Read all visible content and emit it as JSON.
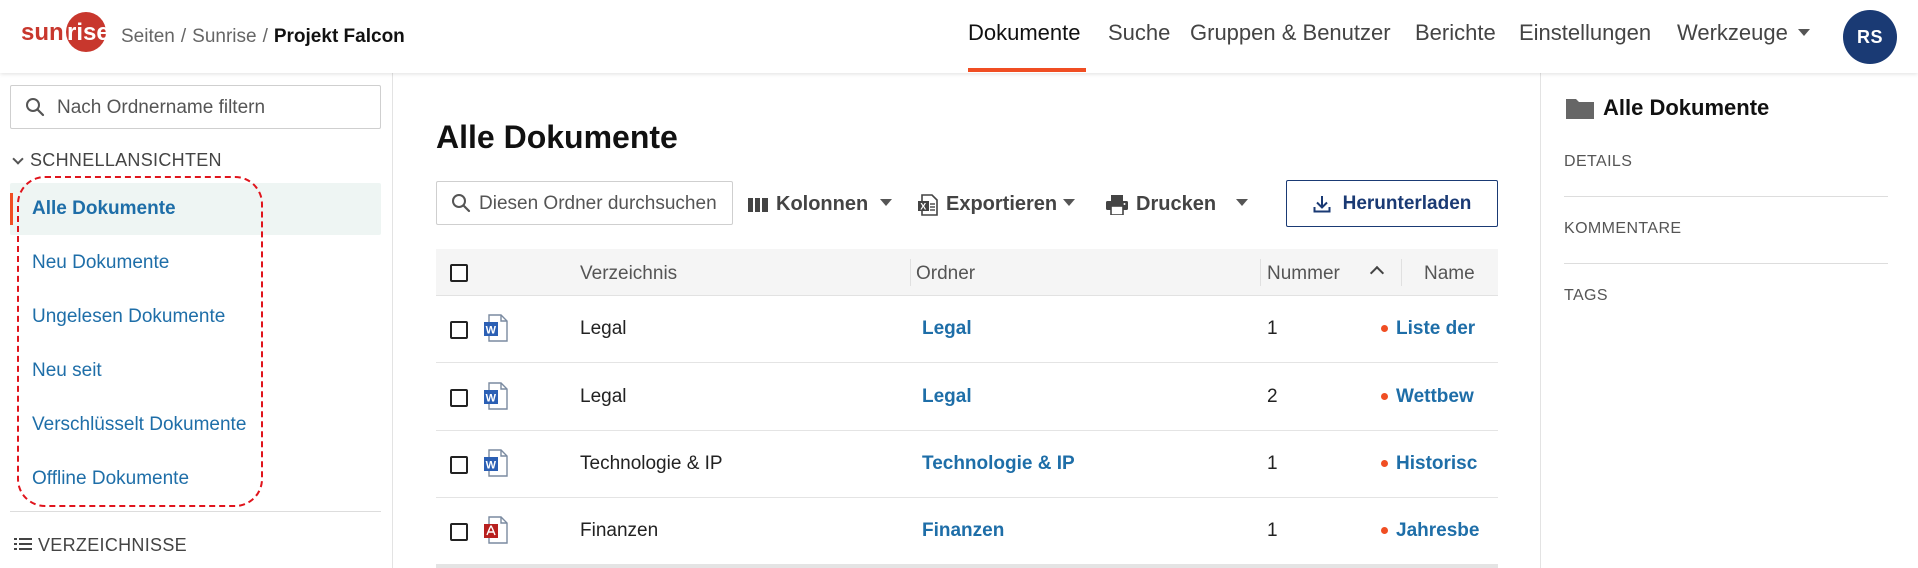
{
  "header": {
    "logo_text": "sunrise",
    "breadcrumb": [
      "Seiten",
      "Sunrise",
      "Projekt Falcon"
    ],
    "breadcrumb_separator": "/",
    "nav": [
      {
        "label": "Dokumente",
        "active": true
      },
      {
        "label": "Suche"
      },
      {
        "label": "Gruppen & Benutzer"
      },
      {
        "label": "Berichte"
      },
      {
        "label": "Einstellungen"
      },
      {
        "label": "Werkzeuge",
        "has_dropdown": true
      }
    ],
    "avatar_initials": "RS"
  },
  "sidebar": {
    "filter_placeholder": "Nach Ordnername filtern",
    "quick_views_heading": "SCHNELLANSICHTEN",
    "quick_views": [
      {
        "label": "Alle Dokumente",
        "active": true
      },
      {
        "label": "Neu Dokumente"
      },
      {
        "label": "Ungelesen Dokumente"
      },
      {
        "label": "Neu seit"
      },
      {
        "label": "Verschlüsselt Dokumente"
      },
      {
        "label": "Offline Dokumente"
      }
    ],
    "directories_heading": "VERZEICHNISSE"
  },
  "main": {
    "title": "Alle Dokumente",
    "search_placeholder": "Diesen Ordner durchsuchen",
    "toolbar": {
      "columns": "Kolonnen",
      "export": "Exportieren",
      "print": "Drucken",
      "download": "Herunterladen"
    },
    "table": {
      "columns": [
        "Verzeichnis",
        "Ordner",
        "Nummer",
        "Name"
      ],
      "rows": [
        {
          "file_type": "word",
          "directory": "Legal",
          "folder": "Legal",
          "number": "1",
          "name": "Liste der"
        },
        {
          "file_type": "word",
          "directory": "Legal",
          "folder": "Legal",
          "number": "2",
          "name": "Wettbew"
        },
        {
          "file_type": "word",
          "directory": "Technologie & IP",
          "folder": "Technologie & IP",
          "number": "1",
          "name": "Historisc"
        },
        {
          "file_type": "pdf",
          "directory": "Finanzen",
          "folder": "Finanzen",
          "number": "1",
          "name": "Jahresbe"
        }
      ]
    }
  },
  "right_panel": {
    "title": "Alle Dokumente",
    "sections": [
      "DETAILS",
      "KOMMENTARE",
      "TAGS"
    ]
  },
  "colors": {
    "brand_red": "#c8372d",
    "accent_orange": "#f04e23",
    "link_blue": "#1e6ea8",
    "navy": "#1a3a74",
    "highlight_red": "#e0141c"
  }
}
